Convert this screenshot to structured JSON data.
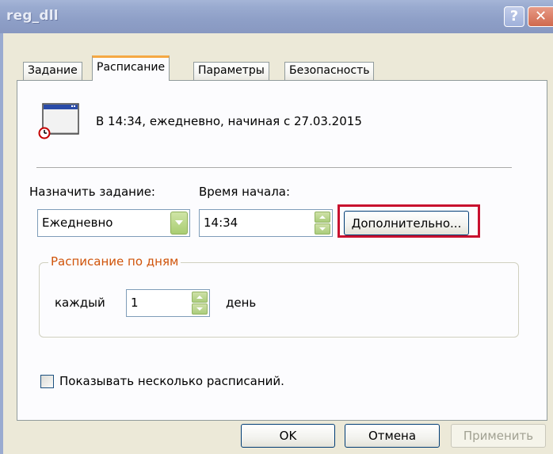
{
  "window": {
    "title": "reg_dll",
    "help_glyph": "?",
    "close_glyph": "✕"
  },
  "tabs": [
    {
      "label": "Задание",
      "active": false
    },
    {
      "label": "Расписание",
      "active": true
    },
    {
      "label": "Параметры",
      "active": false
    },
    {
      "label": "Безопасность",
      "active": false
    }
  ],
  "schedule": {
    "summary": "В 14:34, ежедневно, начиная с 27.03.2015",
    "assign_label": "Назначить задание:",
    "assign_value": "Ежедневно",
    "start_time_label": "Время начала:",
    "start_time_value": "14:34",
    "advanced_button": "Дополнительно...",
    "daily_group": {
      "legend": "Расписание по дням",
      "every_label": "каждый",
      "every_value": "1",
      "unit_label": "день"
    },
    "show_multiple": {
      "label": "Показывать несколько расписаний.",
      "checked": false
    }
  },
  "footer": {
    "ok": "OK",
    "cancel": "Отмена",
    "apply": "Применить",
    "apply_enabled": false
  },
  "colors": {
    "active_tab_accent": "#f5a843",
    "group_legend": "#d0540a",
    "highlight": "#c8102e"
  }
}
